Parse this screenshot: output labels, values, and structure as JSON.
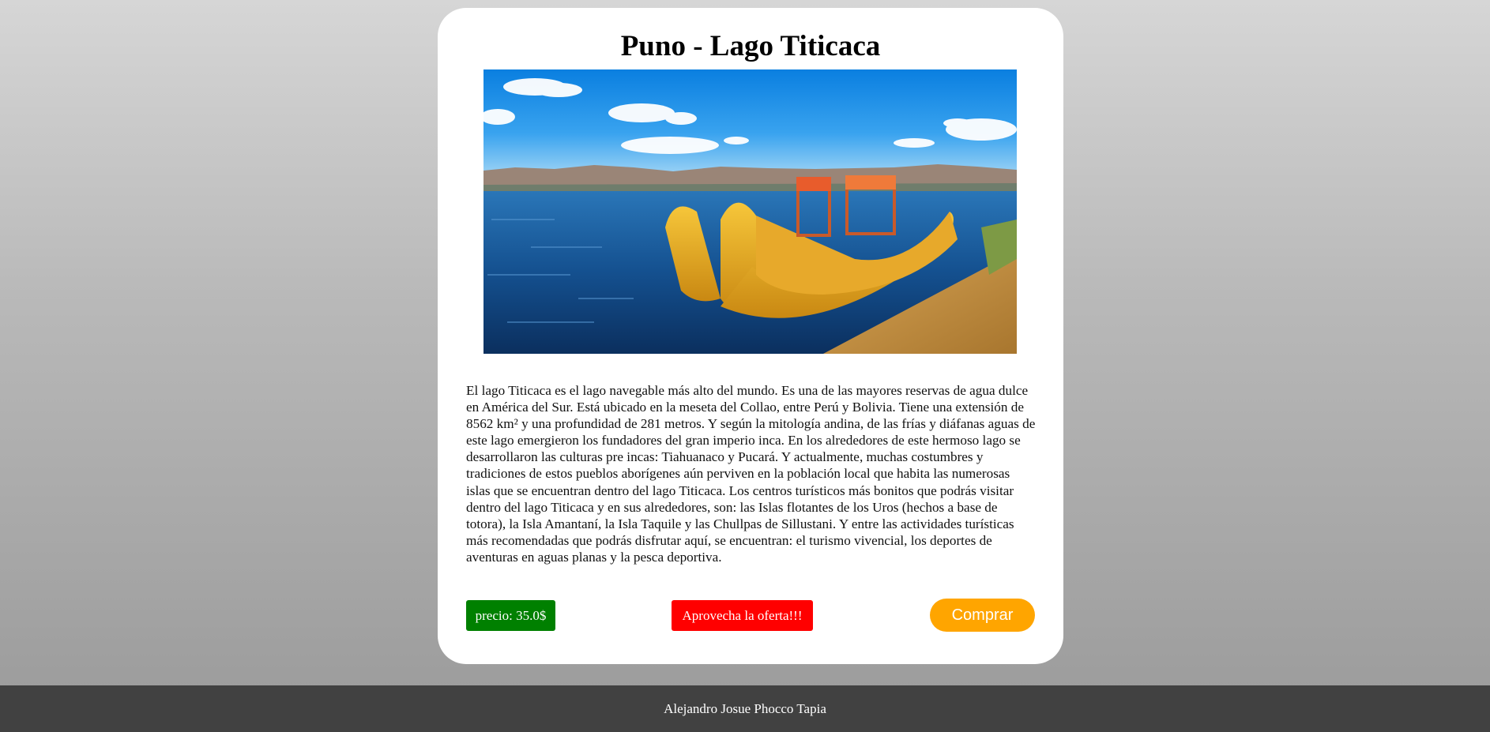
{
  "card": {
    "title": "Puno - Lago Titicaca",
    "image_subject": "reed-boat-on-lake-titicaca",
    "description": "El lago Titicaca es el lago navegable más alto del mundo. Es una de las mayores reservas de agua dulce en América del Sur. Está ubicado en la meseta del Collao, entre Perú y Bolivia. Tiene una extensión de 8562 km² y una profundidad de 281 metros. Y según la mitología andina, de las frías y diáfanas aguas de este lago emergieron los fundadores del gran imperio inca. En los alrededores de este hermoso lago se desarrollaron las culturas pre incas: Tiahuanaco y Pucará. Y actualmente, muchas costumbres y tradiciones de estos pueblos aborígenes aún perviven en la población local que habita las numerosas islas que se encuentran dentro del lago Titicaca. Los centros turísticos más bonitos que podrás visitar dentro del lago Titicaca y en sus alrededores, son: las Islas flotantes de los Uros (hechos a base de totora), la Isla Amantaní, la Isla Taquile y las Chullpas de Sillustani. Y entre las actividades turísticas más recomendadas que podrás disfrutar aquí, se encuentran: el turismo vivencial, los deportes de aventuras en aguas planas y la pesca deportiva.",
    "price_label": "precio: 35.0$",
    "offer_label": "Aprovecha la oferta!!!",
    "buy_label": "Comprar"
  },
  "footer": {
    "author": "Alejandro Josue Phocco Tapia"
  },
  "colors": {
    "price_bg": "#008000",
    "offer_bg": "#ff0000",
    "buy_bg": "#ffa500",
    "footer_bg": "#414141"
  }
}
